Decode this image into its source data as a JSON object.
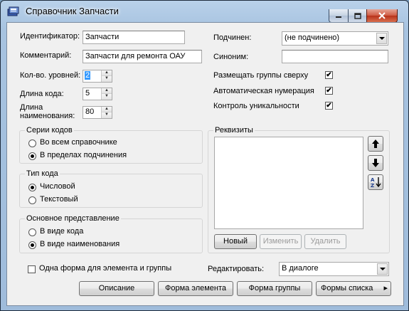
{
  "window": {
    "title": "Справочник Запчасти",
    "controls": [
      "minimize-icon",
      "maximize-icon",
      "close-icon"
    ]
  },
  "form": {
    "identifier": {
      "label": "Идентификатор:",
      "value": "Запчасти"
    },
    "comment": {
      "label": "Комментарий:",
      "value": "Запчасти для ремонта ОАУ"
    },
    "levels": {
      "label": "Кол-во. уровней:",
      "value": "2"
    },
    "code_length": {
      "label": "Длина кода:",
      "value": "5"
    },
    "name_length": {
      "label_line1": "Длина",
      "label_line2": "наименования:",
      "value": "80"
    },
    "subordinate": {
      "label": "Подчинен:",
      "value": "(не подчинено)"
    },
    "synonym": {
      "label": "Синоним:",
      "value": ""
    },
    "checks": [
      {
        "label": "Размещать группы сверху",
        "checked": true
      },
      {
        "label": "Автоматическая нумерация",
        "checked": true
      },
      {
        "label": "Контроль уникальности",
        "checked": true
      }
    ]
  },
  "code_series": {
    "title": "Серии кодов",
    "options": [
      "Во всем справочнике",
      "В пределах подчинения"
    ],
    "selected": 1
  },
  "code_type": {
    "title": "Тип кода",
    "options": [
      "Числовой",
      "Текстовый"
    ],
    "selected": 0
  },
  "main_view": {
    "title": "Основное представление",
    "options": [
      "В виде кода",
      "В виде наименования"
    ],
    "selected": 1
  },
  "requisites": {
    "title": "Реквизиты",
    "items": [],
    "buttons": {
      "new": "Новый",
      "edit": "Изменить",
      "delete": "Удалить"
    },
    "side_icons": [
      "arrow-up-icon",
      "arrow-down-icon",
      "sort-az-icon"
    ]
  },
  "footer": {
    "single_form": {
      "label": "Одна форма для элемента и группы",
      "checked": false
    },
    "edit": {
      "label": "Редактировать:",
      "value": "В диалоге"
    },
    "buttons": {
      "description": "Описание",
      "element_form": "Форма элемента",
      "group_form": "Форма группы",
      "list_forms": "Формы списка"
    }
  }
}
